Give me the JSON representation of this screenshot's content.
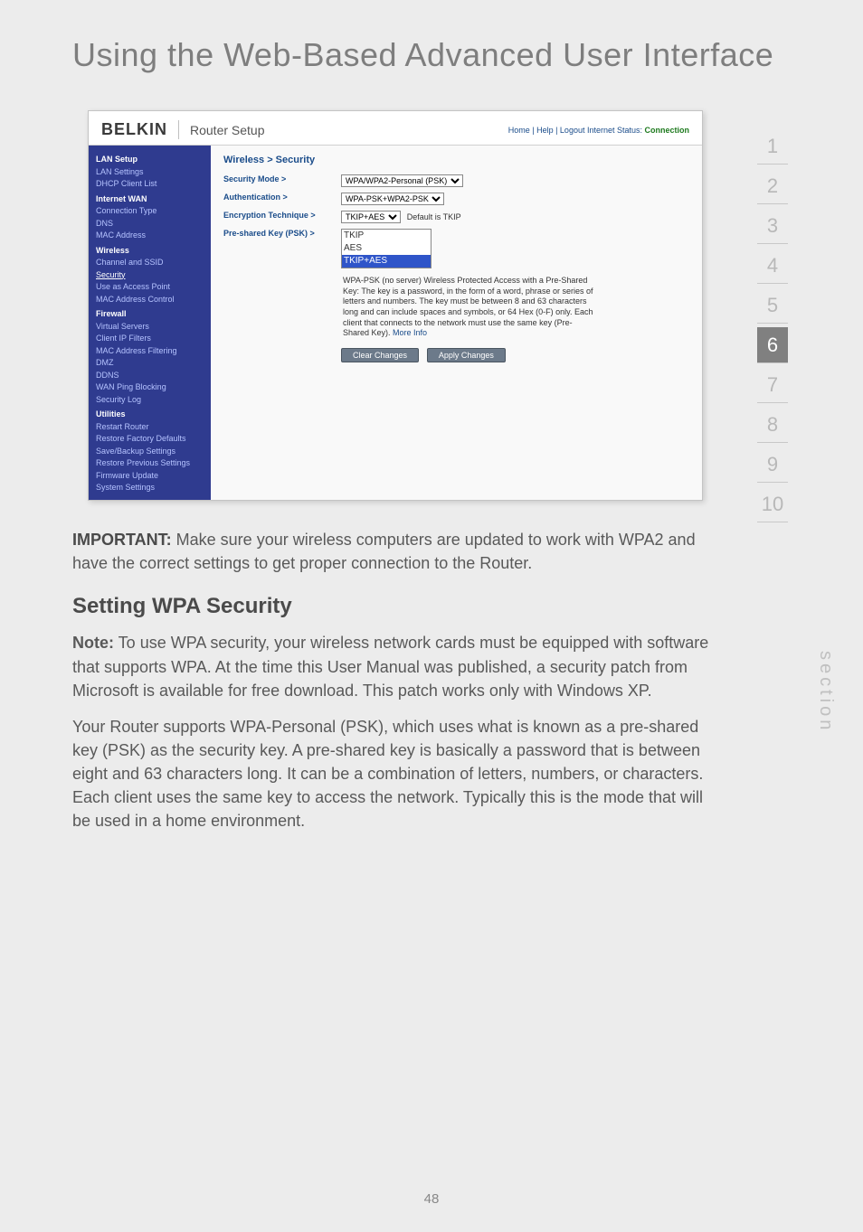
{
  "chapter_title": "Using the Web-Based Advanced User Interface",
  "page_number": "48",
  "section_label": "section",
  "pager": [
    "1",
    "2",
    "3",
    "4",
    "5",
    "6",
    "7",
    "8",
    "9",
    "10"
  ],
  "pager_active_index": 5,
  "router": {
    "brand": "BELKIN",
    "title": "Router Setup",
    "toplinks_prefix": "Home | Help | Logout   Internet Status: ",
    "toplinks_status": "Connection",
    "sidebar": {
      "items": [
        {
          "label": "LAN Setup",
          "cls": "cat"
        },
        {
          "label": "LAN Settings"
        },
        {
          "label": "DHCP Client List"
        },
        {
          "label": "Internet WAN",
          "cls": "cat"
        },
        {
          "label": "Connection Type"
        },
        {
          "label": "DNS"
        },
        {
          "label": "MAC Address"
        },
        {
          "label": "Wireless",
          "cls": "cat"
        },
        {
          "label": "Channel and SSID"
        },
        {
          "label": "Security",
          "cls": "sel"
        },
        {
          "label": "Use as Access Point"
        },
        {
          "label": "MAC Address Control"
        },
        {
          "label": "Firewall",
          "cls": "cat"
        },
        {
          "label": "Virtual Servers"
        },
        {
          "label": "Client IP Filters"
        },
        {
          "label": "MAC Address Filtering"
        },
        {
          "label": "DMZ"
        },
        {
          "label": "DDNS"
        },
        {
          "label": "WAN Ping Blocking"
        },
        {
          "label": "Security Log"
        },
        {
          "label": "Utilities",
          "cls": "cat"
        },
        {
          "label": "Restart Router"
        },
        {
          "label": "Restore Factory Defaults"
        },
        {
          "label": "Save/Backup Settings"
        },
        {
          "label": "Restore Previous Settings"
        },
        {
          "label": "Firmware Update"
        },
        {
          "label": "System Settings"
        }
      ]
    },
    "panel": {
      "title": "Wireless > Security",
      "rows": {
        "security_mode_label": "Security Mode >",
        "security_mode_value": "WPA/WPA2-Personal (PSK)",
        "authentication_label": "Authentication >",
        "authentication_value": "WPA-PSK+WPA2-PSK",
        "encryption_label": "Encryption Technique >",
        "encryption_value": "TKIP+AES",
        "encryption_note": "Default is TKIP",
        "psk_label": "Pre-shared Key (PSK) >"
      },
      "auth_options": [
        "TKIP",
        "AES",
        "TKIP+AES"
      ],
      "auth_selected_index": 2,
      "info_text": "WPA-PSK (no server) Wireless Protected Access with a Pre-Shared Key: The key is a password, in the form of a word, phrase or series of letters and numbers. The key must be between 8 and 63 characters long and can include spaces and symbols, or 64 Hex (0-F) only. Each client that connects to the network must use the same key (Pre-Shared Key). ",
      "info_link": "More Info",
      "buttons": {
        "clear": "Clear Changes",
        "apply": "Apply Changes"
      }
    }
  },
  "important": {
    "label": "IMPORTANT:",
    "text": " Make sure your wireless computers are updated to work with WPA2 and have the correct settings to get proper connection to the Router."
  },
  "wpa": {
    "heading": "Setting WPA Security",
    "note_label": "Note:",
    "note_text": " To use WPA security, your wireless network cards must be equipped with software that supports WPA. At the time this User Manual was published, a security patch from Microsoft is available for free download. This patch works only with Windows XP.",
    "para2": "Your Router supports WPA-Personal (PSK), which uses what is known as a pre-shared key (PSK) as the security key. A pre-shared key is basically a password that is between eight and 63 characters long. It can be a combination of letters, numbers, or characters. Each client uses the same key to access the network. Typically this is the mode that will be used in a home environment."
  }
}
